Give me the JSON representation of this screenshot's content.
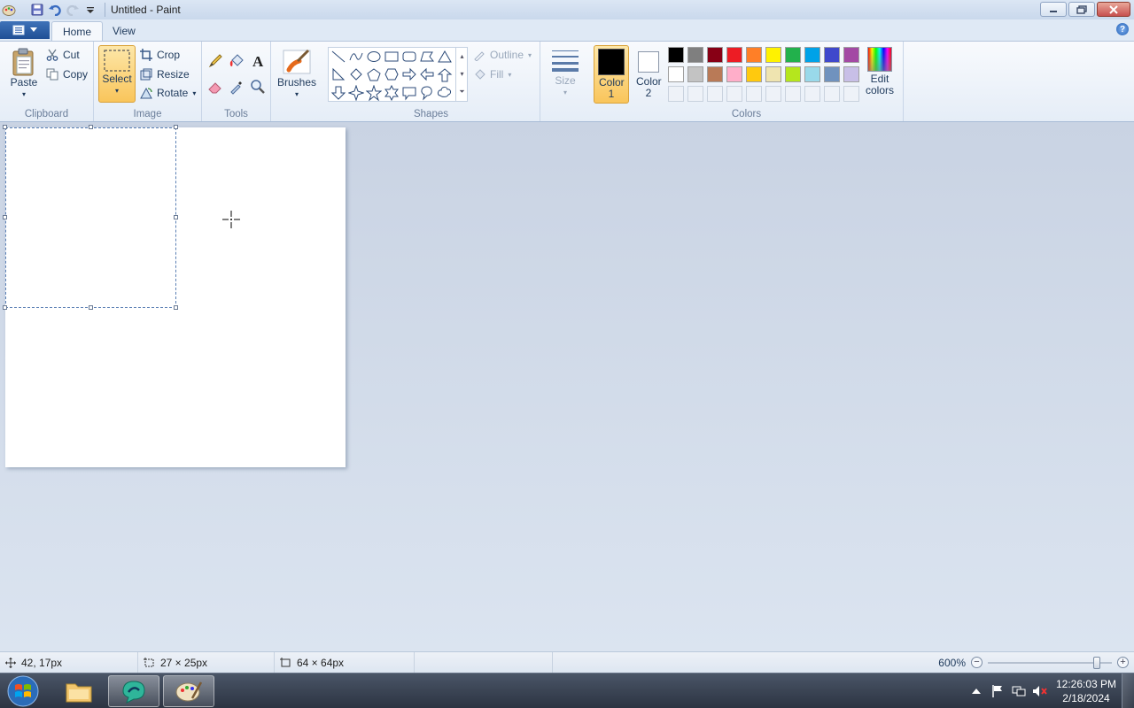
{
  "window": {
    "title": "Untitled - Paint"
  },
  "tabs": [
    {
      "label": "Home"
    },
    {
      "label": "View"
    }
  ],
  "clipboard": {
    "paste": "Paste",
    "cut": "Cut",
    "copy": "Copy",
    "group": "Clipboard"
  },
  "image": {
    "select": "Select",
    "crop": "Crop",
    "resize": "Resize",
    "rotate": "Rotate",
    "group": "Image"
  },
  "tools": {
    "group": "Tools"
  },
  "brushes": {
    "label": "Brushes"
  },
  "shapes": {
    "outline": "Outline",
    "fill": "Fill",
    "group": "Shapes"
  },
  "size": {
    "label": "Size"
  },
  "colors": {
    "color1": "Color 1",
    "color1_value": "#000000",
    "color2": "Color 2",
    "color2_value": "#ffffff",
    "edit": "Edit colors",
    "group": "Colors",
    "palette_row1": [
      "#000000",
      "#7f7f7f",
      "#880015",
      "#ed1c24",
      "#ff7f27",
      "#fff200",
      "#22b14c",
      "#00a2e8",
      "#3f48cc",
      "#a349a4"
    ],
    "palette_row2": [
      "#ffffff",
      "#c3c3c3",
      "#b97a57",
      "#ffaec9",
      "#ffc90e",
      "#efe4b0",
      "#b5e61d",
      "#99d9ea",
      "#7092be",
      "#c8bfe7"
    ]
  },
  "status": {
    "cursor_pos": "42, 17px",
    "selection_size": "27 × 25px",
    "image_size": "64 × 64px",
    "zoom": "600%",
    "zoom_level": 0.9
  },
  "taskbar": {
    "time": "12:26:03 PM",
    "date": "2/18/2024"
  }
}
